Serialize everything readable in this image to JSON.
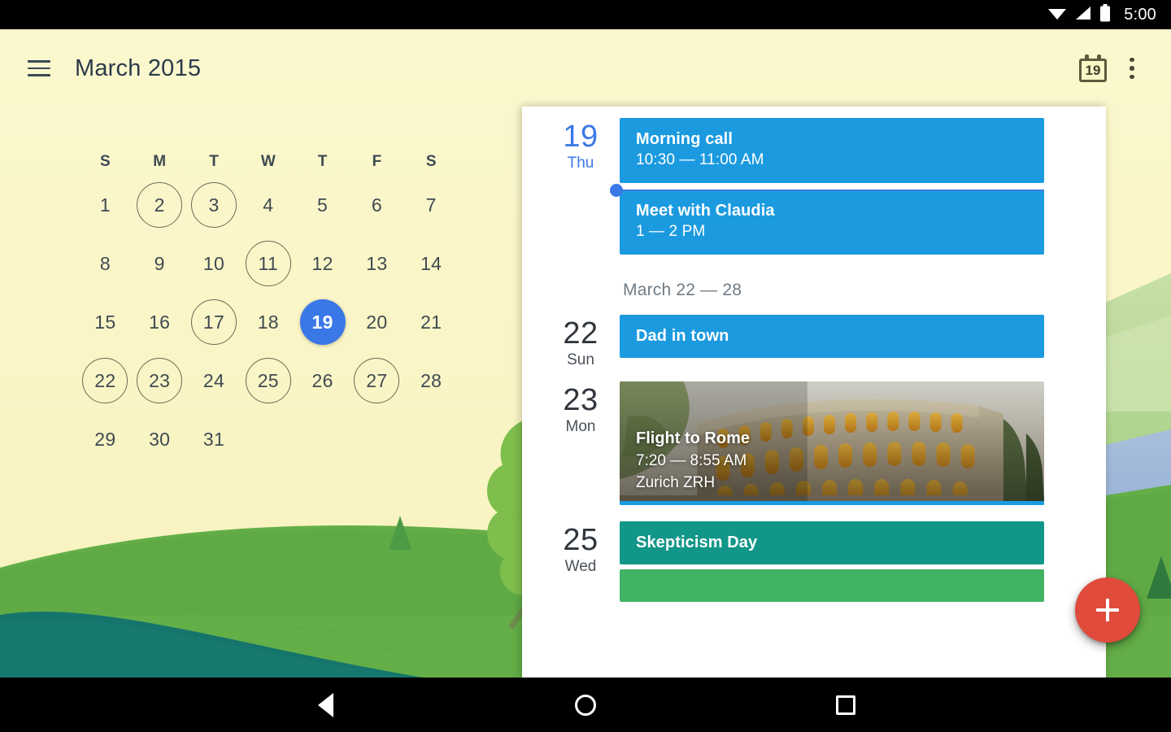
{
  "statusbar": {
    "time": "5:00",
    "icons": [
      "wifi-icon",
      "signal-icon",
      "battery-icon"
    ]
  },
  "appbar": {
    "title": "March 2015",
    "menu_icon": "hamburger-menu-icon",
    "today_icon_label": "19",
    "overflow_icon": "more-vertical-icon"
  },
  "month": {
    "weekday_headers": [
      "S",
      "M",
      "T",
      "W",
      "T",
      "F",
      "S"
    ],
    "weeks": [
      [
        {
          "n": "1",
          "state": "normal"
        },
        {
          "n": "2",
          "state": "ring"
        },
        {
          "n": "3",
          "state": "ring"
        },
        {
          "n": "4",
          "state": "normal"
        },
        {
          "n": "5",
          "state": "normal"
        },
        {
          "n": "6",
          "state": "normal"
        },
        {
          "n": "7",
          "state": "normal"
        }
      ],
      [
        {
          "n": "8",
          "state": "normal"
        },
        {
          "n": "9",
          "state": "normal"
        },
        {
          "n": "10",
          "state": "normal"
        },
        {
          "n": "11",
          "state": "ring"
        },
        {
          "n": "12",
          "state": "normal"
        },
        {
          "n": "13",
          "state": "normal"
        },
        {
          "n": "14",
          "state": "normal"
        }
      ],
      [
        {
          "n": "15",
          "state": "normal"
        },
        {
          "n": "16",
          "state": "normal"
        },
        {
          "n": "17",
          "state": "ring"
        },
        {
          "n": "18",
          "state": "normal"
        },
        {
          "n": "19",
          "state": "today"
        },
        {
          "n": "20",
          "state": "normal"
        },
        {
          "n": "21",
          "state": "normal"
        }
      ],
      [
        {
          "n": "22",
          "state": "ring"
        },
        {
          "n": "23",
          "state": "ring"
        },
        {
          "n": "24",
          "state": "normal"
        },
        {
          "n": "25",
          "state": "ring"
        },
        {
          "n": "26",
          "state": "normal"
        },
        {
          "n": "27",
          "state": "ring"
        },
        {
          "n": "28",
          "state": "normal"
        }
      ],
      [
        {
          "n": "29",
          "state": "normal"
        },
        {
          "n": "30",
          "state": "normal"
        },
        {
          "n": "31",
          "state": "normal"
        },
        {
          "n": "",
          "state": "empty"
        },
        {
          "n": "",
          "state": "empty"
        },
        {
          "n": "",
          "state": "empty"
        },
        {
          "n": "",
          "state": "empty"
        }
      ]
    ]
  },
  "agenda": {
    "today": {
      "day": "19",
      "weekday": "Thu"
    },
    "today_events": [
      {
        "title": "Morning call",
        "time": "10:30 — 11:00 AM",
        "color": "#1b9ae0"
      },
      {
        "title": "Meet with Claudia",
        "time": "1 — 2 PM",
        "color": "#1b9ae0"
      }
    ],
    "now_indicator": "current-time-indicator",
    "week_header": "March 22 — 28",
    "days": [
      {
        "day": "22",
        "weekday": "Sun",
        "events": [
          {
            "kind": "plain",
            "title": "Dad in town",
            "time": "",
            "color": "#1b9ae0"
          }
        ]
      },
      {
        "day": "23",
        "weekday": "Mon",
        "events": [
          {
            "kind": "photo",
            "title": "Flight to Rome",
            "time": "7:20 — 8:55 AM",
            "location": "Zurich ZRH",
            "photo": "colosseum-rome-photo",
            "strip_color": "#1b9ae0"
          }
        ]
      },
      {
        "day": "25",
        "weekday": "Wed",
        "events": [
          {
            "kind": "plain",
            "title": "Skepticism Day",
            "time": "",
            "color": "#129688"
          },
          {
            "kind": "plain",
            "title": "",
            "time": "",
            "color": "#42b363"
          }
        ]
      }
    ]
  },
  "fab": {
    "icon": "plus-icon",
    "color": "#e04b3c"
  },
  "navbar": {
    "back": "back-icon",
    "home": "home-icon",
    "recents": "recents-icon"
  },
  "colors": {
    "wallpaper_sky": "#FAF6C8",
    "accent_blue": "#3b78e7",
    "event_blue": "#1b9ae0",
    "event_teal": "#129688",
    "event_green": "#42b363",
    "fab_red": "#e04b3c"
  }
}
